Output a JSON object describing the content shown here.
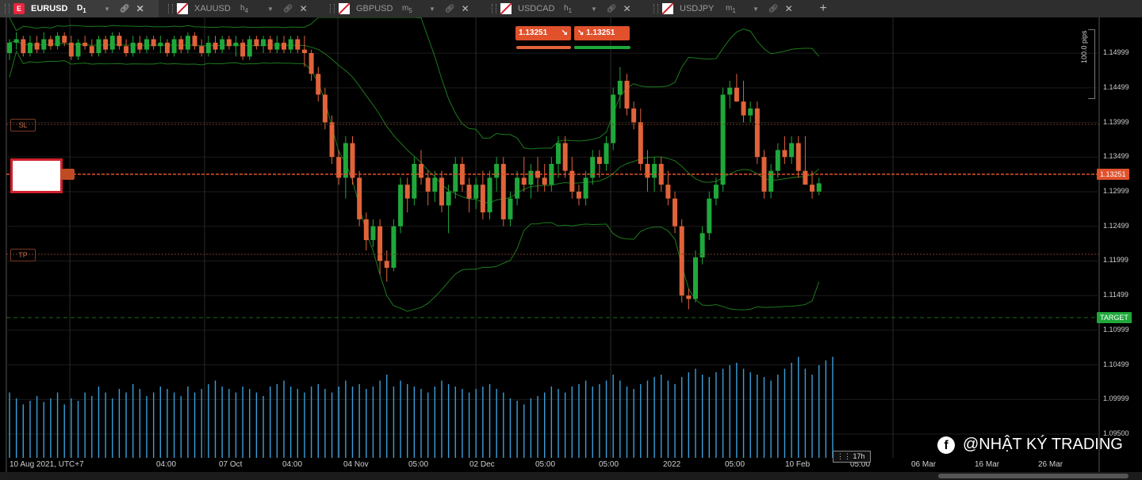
{
  "tabs": [
    {
      "symbol": "EURUSD",
      "tf": "D",
      "tf_sub": "1",
      "icon": "E",
      "active": true
    },
    {
      "symbol": "XAUUSD",
      "tf": "h",
      "tf_sub": "4",
      "active": false
    },
    {
      "symbol": "GBPUSD",
      "tf": "m",
      "tf_sub": "5",
      "active": false
    },
    {
      "symbol": "USDCAD",
      "tf": "h",
      "tf_sub": "1",
      "active": false
    },
    {
      "symbol": "USDJPY",
      "tf": "m",
      "tf_sub": "1",
      "active": false
    }
  ],
  "add_tab": "+",
  "trade_panel": {
    "sell_price": "1.13251",
    "buy_price": "1.13251"
  },
  "markers": {
    "sl": "SL",
    "tp": "TP",
    "target": "TARGET"
  },
  "price_axis": {
    "levels": [
      "1.14999",
      "1.14499",
      "1.13999",
      "1.13499",
      "1.12999",
      "1.12499",
      "1.11999",
      "1.11499",
      "1.10999",
      "1.10499",
      "1.09999",
      "1.09500"
    ],
    "current_price": "1.13251",
    "pip_range": "100.0 pips"
  },
  "time_axis": [
    "10 Aug 2021, UTC+7",
    "04:00",
    "07 Oct",
    "04:00",
    "04 Nov",
    "05:00",
    "02 Dec",
    "05:00",
    "05:00",
    "2022",
    "05:00",
    "10 Feb",
    "05:00",
    "06 Mar",
    "16 Mar",
    "26 Mar"
  ],
  "countdown": "17h",
  "watermark": "@NHẬT KÝ TRADING",
  "colors": {
    "bull": "#1fa83a",
    "bear": "#e0633a",
    "volume": "#3a9fd8",
    "bands": "#1c7a1c",
    "price_line": "#e0512c",
    "target": "#1fa83a"
  },
  "chart_data": {
    "type": "candlestick",
    "symbol": "EURUSD",
    "timeframe": "D1",
    "ylim": [
      1.0925,
      1.1525
    ],
    "candles": [
      [
        1.15,
        1.152,
        1.149,
        1.1515
      ],
      [
        1.1515,
        1.153,
        1.1505,
        1.152
      ],
      [
        1.152,
        1.1525,
        1.1495,
        1.15
      ],
      [
        1.15,
        1.1525,
        1.1495,
        1.1515
      ],
      [
        1.1515,
        1.1525,
        1.15,
        1.1505
      ],
      [
        1.1505,
        1.153,
        1.15,
        1.152
      ],
      [
        1.152,
        1.1525,
        1.1505,
        1.151
      ],
      [
        1.151,
        1.153,
        1.1505,
        1.1525
      ],
      [
        1.1525,
        1.153,
        1.151,
        1.1515
      ],
      [
        1.1515,
        1.1525,
        1.149,
        1.1495
      ],
      [
        1.1495,
        1.152,
        1.149,
        1.1515
      ],
      [
        1.1515,
        1.1525,
        1.1505,
        1.151
      ],
      [
        1.151,
        1.152,
        1.1495,
        1.15
      ],
      [
        1.15,
        1.1525,
        1.1495,
        1.152
      ],
      [
        1.152,
        1.1525,
        1.15,
        1.1505
      ],
      [
        1.1505,
        1.153,
        1.15,
        1.1525
      ],
      [
        1.1525,
        1.153,
        1.1505,
        1.151
      ],
      [
        1.151,
        1.152,
        1.1495,
        1.15
      ],
      [
        1.15,
        1.1525,
        1.1495,
        1.1515
      ],
      [
        1.1515,
        1.1525,
        1.15,
        1.1505
      ],
      [
        1.1505,
        1.1525,
        1.15,
        1.152
      ],
      [
        1.152,
        1.1525,
        1.1505,
        1.151
      ],
      [
        1.151,
        1.1525,
        1.15,
        1.1515
      ],
      [
        1.1515,
        1.152,
        1.1495,
        1.15
      ],
      [
        1.15,
        1.1525,
        1.1495,
        1.152
      ],
      [
        1.152,
        1.1525,
        1.15,
        1.1505
      ],
      [
        1.1505,
        1.153,
        1.15,
        1.1525
      ],
      [
        1.1525,
        1.153,
        1.1505,
        1.151
      ],
      [
        1.151,
        1.152,
        1.1495,
        1.15
      ],
      [
        1.15,
        1.1525,
        1.1495,
        1.1515
      ],
      [
        1.1515,
        1.1525,
        1.15,
        1.1505
      ],
      [
        1.1505,
        1.1525,
        1.15,
        1.152
      ],
      [
        1.152,
        1.1525,
        1.1505,
        1.151
      ],
      [
        1.151,
        1.1525,
        1.1495,
        1.1515
      ],
      [
        1.1515,
        1.152,
        1.149,
        1.1495
      ],
      [
        1.1495,
        1.1525,
        1.149,
        1.152
      ],
      [
        1.152,
        1.1525,
        1.1505,
        1.151
      ],
      [
        1.151,
        1.1525,
        1.15,
        1.152
      ],
      [
        1.152,
        1.1525,
        1.15,
        1.1505
      ],
      [
        1.1505,
        1.1525,
        1.15,
        1.1515
      ],
      [
        1.1515,
        1.1525,
        1.15,
        1.1505
      ],
      [
        1.1505,
        1.1525,
        1.15,
        1.152
      ],
      [
        1.152,
        1.1525,
        1.15,
        1.1505
      ],
      [
        1.1505,
        1.1525,
        1.148,
        1.15
      ],
      [
        1.15,
        1.1505,
        1.146,
        1.147
      ],
      [
        1.147,
        1.148,
        1.143,
        1.144
      ],
      [
        1.144,
        1.145,
        1.139,
        1.14
      ],
      [
        1.14,
        1.141,
        1.134,
        1.135
      ],
      [
        1.135,
        1.136,
        1.131,
        1.132
      ],
      [
        1.132,
        1.138,
        1.129,
        1.137
      ],
      [
        1.137,
        1.138,
        1.131,
        1.132
      ],
      [
        1.132,
        1.133,
        1.125,
        1.126
      ],
      [
        1.126,
        1.127,
        1.1215,
        1.123
      ],
      [
        1.123,
        1.126,
        1.122,
        1.125
      ],
      [
        1.125,
        1.126,
        1.118,
        1.12
      ],
      [
        1.12,
        1.1215,
        1.117,
        1.119
      ],
      [
        1.119,
        1.126,
        1.1185,
        1.125
      ],
      [
        1.125,
        1.132,
        1.124,
        1.131
      ],
      [
        1.131,
        1.132,
        1.127,
        1.129
      ],
      [
        1.129,
        1.135,
        1.128,
        1.134
      ],
      [
        1.134,
        1.136,
        1.131,
        1.132
      ],
      [
        1.132,
        1.133,
        1.128,
        1.13
      ],
      [
        1.13,
        1.133,
        1.1285,
        1.132
      ],
      [
        1.132,
        1.133,
        1.127,
        1.128
      ],
      [
        1.128,
        1.131,
        1.124,
        1.13
      ],
      [
        1.13,
        1.135,
        1.129,
        1.134
      ],
      [
        1.134,
        1.135,
        1.13,
        1.131
      ],
      [
        1.131,
        1.132,
        1.127,
        1.129
      ],
      [
        1.129,
        1.132,
        1.1275,
        1.131
      ],
      [
        1.131,
        1.133,
        1.126,
        1.127
      ],
      [
        1.127,
        1.133,
        1.126,
        1.132
      ],
      [
        1.132,
        1.135,
        1.13,
        1.134
      ],
      [
        1.134,
        1.135,
        1.125,
        1.126
      ],
      [
        1.126,
        1.13,
        1.125,
        1.129
      ],
      [
        1.129,
        1.133,
        1.128,
        1.132
      ],
      [
        1.132,
        1.135,
        1.13,
        1.131
      ],
      [
        1.131,
        1.134,
        1.129,
        1.133
      ],
      [
        1.133,
        1.135,
        1.13,
        1.132
      ],
      [
        1.132,
        1.134,
        1.13,
        1.131
      ],
      [
        1.131,
        1.135,
        1.13,
        1.134
      ],
      [
        1.134,
        1.138,
        1.132,
        1.137
      ],
      [
        1.137,
        1.138,
        1.132,
        1.133
      ],
      [
        1.133,
        1.135,
        1.129,
        1.13
      ],
      [
        1.13,
        1.131,
        1.128,
        1.129
      ],
      [
        1.129,
        1.133,
        1.128,
        1.132
      ],
      [
        1.132,
        1.136,
        1.131,
        1.135
      ],
      [
        1.135,
        1.136,
        1.132,
        1.134
      ],
      [
        1.134,
        1.138,
        1.133,
        1.137
      ],
      [
        1.137,
        1.145,
        1.136,
        1.144
      ],
      [
        1.144,
        1.148,
        1.142,
        1.146
      ],
      [
        1.146,
        1.147,
        1.141,
        1.142
      ],
      [
        1.142,
        1.143,
        1.139,
        1.14
      ],
      [
        1.14,
        1.142,
        1.133,
        1.134
      ],
      [
        1.134,
        1.136,
        1.13,
        1.132
      ],
      [
        1.132,
        1.135,
        1.13,
        1.134
      ],
      [
        1.134,
        1.135,
        1.13,
        1.131
      ],
      [
        1.131,
        1.133,
        1.128,
        1.129
      ],
      [
        1.129,
        1.13,
        1.124,
        1.125
      ],
      [
        1.125,
        1.126,
        1.114,
        1.115
      ],
      [
        1.115,
        1.116,
        1.113,
        1.1145
      ],
      [
        1.1145,
        1.1215,
        1.114,
        1.1205
      ],
      [
        1.1205,
        1.125,
        1.1195,
        1.124
      ],
      [
        1.124,
        1.13,
        1.123,
        1.129
      ],
      [
        1.129,
        1.132,
        1.128,
        1.131
      ],
      [
        1.131,
        1.145,
        1.13,
        1.144
      ],
      [
        1.144,
        1.146,
        1.142,
        1.145
      ],
      [
        1.145,
        1.147,
        1.143,
        1.143
      ],
      [
        1.143,
        1.146,
        1.14,
        1.141
      ],
      [
        1.141,
        1.143,
        1.14,
        1.142
      ],
      [
        1.142,
        1.143,
        1.134,
        1.135
      ],
      [
        1.135,
        1.136,
        1.129,
        1.13
      ],
      [
        1.13,
        1.134,
        1.129,
        1.133
      ],
      [
        1.133,
        1.137,
        1.132,
        1.136
      ],
      [
        1.136,
        1.138,
        1.134,
        1.135
      ],
      [
        1.135,
        1.138,
        1.134,
        1.137
      ],
      [
        1.137,
        1.138,
        1.132,
        1.133
      ],
      [
        1.133,
        1.138,
        1.131,
        1.131
      ],
      [
        1.131,
        1.133,
        1.129,
        1.13
      ],
      [
        1.13,
        1.132,
        1.1295,
        1.1312
      ]
    ],
    "volume_relative": [
      0.55,
      0.5,
      0.45,
      0.48,
      0.52,
      0.47,
      0.5,
      0.55,
      0.45,
      0.5,
      0.48,
      0.55,
      0.52,
      0.6,
      0.55,
      0.5,
      0.58,
      0.55,
      0.62,
      0.58,
      0.52,
      0.55,
      0.6,
      0.58,
      0.55,
      0.52,
      0.6,
      0.55,
      0.58,
      0.62,
      0.65,
      0.6,
      0.58,
      0.55,
      0.6,
      0.58,
      0.55,
      0.52,
      0.6,
      0.62,
      0.65,
      0.6,
      0.58,
      0.55,
      0.6,
      0.62,
      0.58,
      0.55,
      0.6,
      0.65,
      0.6,
      0.62,
      0.58,
      0.6,
      0.65,
      0.7,
      0.6,
      0.65,
      0.62,
      0.6,
      0.58,
      0.55,
      0.6,
      0.65,
      0.62,
      0.6,
      0.58,
      0.55,
      0.58,
      0.6,
      0.62,
      0.58,
      0.55,
      0.5,
      0.48,
      0.45,
      0.5,
      0.52,
      0.55,
      0.6,
      0.58,
      0.55,
      0.6,
      0.62,
      0.65,
      0.6,
      0.62,
      0.65,
      0.7,
      0.65,
      0.6,
      0.58,
      0.62,
      0.65,
      0.68,
      0.7,
      0.65,
      0.62,
      0.68,
      0.72,
      0.75,
      0.7,
      0.68,
      0.72,
      0.75,
      0.78,
      0.8,
      0.75,
      0.72,
      0.7,
      0.68,
      0.65,
      0.7,
      0.75,
      0.8,
      0.85,
      0.75,
      0.7,
      0.78,
      0.82,
      0.85
    ]
  }
}
